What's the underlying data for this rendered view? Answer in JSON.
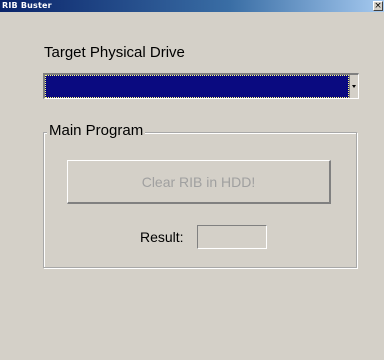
{
  "window": {
    "title": "RIB Buster",
    "close_glyph": "×"
  },
  "drive": {
    "label": "Target Physical Drive",
    "selected_value": ""
  },
  "main_program": {
    "legend": "Main Program",
    "clear_button_label": "Clear RIB in HDD!",
    "clear_button_enabled": false,
    "result_label": "Result:",
    "result_value": ""
  },
  "colors": {
    "window_bg": "#d4d0c8",
    "selection_bg": "#0a0a80",
    "disabled_text": "#a0a0a0"
  }
}
